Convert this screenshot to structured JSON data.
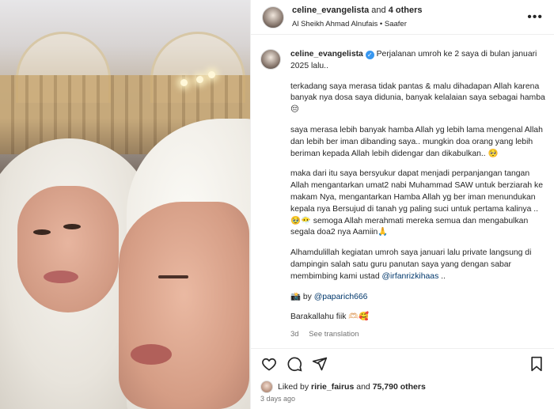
{
  "header": {
    "username": "celine_evangelista",
    "and_text": "and",
    "others": "4 others",
    "audio": "Al Sheikh Ahmad Alnufais • Saafer"
  },
  "caption": {
    "username": "celine_evangelista",
    "first_line": "Perjalanan umroh ke 2 saya di bulan januari 2025 lalu..",
    "p1": "terkadang saya merasa tidak pantas & malu dihadapan Allah karena banyak nya dosa saya didunia, banyak kelalaian saya sebagai hamba 😔",
    "p2": "saya merasa lebih banyak hamba Allah yg lebih lama mengenal Allah dan lebih ber iman dibanding saya.. mungkin doa orang yang lebih beriman kepada Allah lebih didengar dan dikabulkan.. 🥺",
    "p3": "maka dari itu saya bersyukur dapat menjadi perpanjangan tangan Allah mengantarkan umat2 nabi Muhammad SAW untuk berziarah ke makam Nya, mengantarkan Hamba Allah yg ber iman menundukan kepala nya Bersujud di tanah yg paling suci untuk pertama kalinya .. 🥹😶‍🌫️ semoga Allah merahmati mereka semua dan mengabulkan segala doa2 nya Aamiin🙏",
    "p4_text": "Alhamdulillah kegiatan umroh saya januari lalu private langsung di dampingin salah satu guru panutan saya yang dengan sabar membimbing kami ustad",
    "p4_mention": "@irfanrizkihaas",
    "p4_end": "..",
    "credit_prefix": "📸 by",
    "credit_mention": "@paparich666",
    "closing": "Barakallahu fiik 🫶🏻🥰",
    "time": "3d",
    "see_translation": "See translation"
  },
  "likes": {
    "prefix": "Liked by",
    "user": "ririe_fairus",
    "and": "and",
    "count": "75,790 others"
  },
  "ago": "3 days ago",
  "icons": [
    "heart-icon",
    "comment-icon",
    "share-icon",
    "bookmark-icon",
    "more-icon",
    "verified-icon"
  ]
}
